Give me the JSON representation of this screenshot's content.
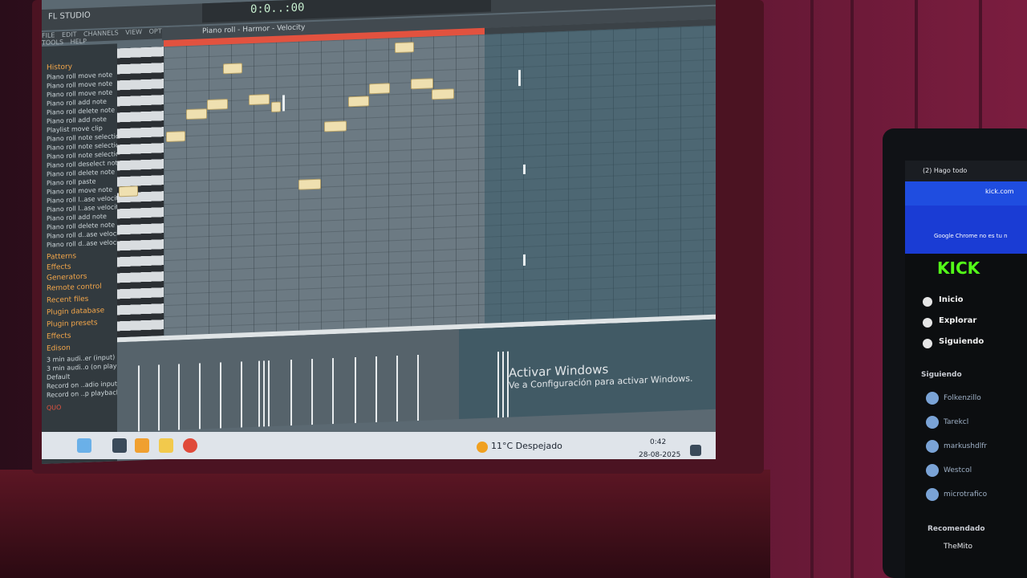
{
  "fl_studio": {
    "app_title": "FL STUDIO",
    "time_display": "0:0..:00",
    "menu": [
      "FILE",
      "EDIT",
      "CHANNELS",
      "VIEW",
      "OPTIONS",
      "TOOLS",
      "HELP"
    ],
    "piano_roll_title": "Piano roll - Harmor - Velocity",
    "browser": {
      "history_label": "History",
      "history_items": [
        "Piano roll move note",
        "Piano roll move note",
        "Piano roll move note",
        "Piano roll add note",
        "Piano roll delete note",
        "Piano roll add note",
        "Playlist move clip",
        "Piano roll note selection",
        "Piano roll note selection",
        "Piano roll note selection",
        "Piano roll deselect note",
        "Piano roll delete note",
        "Piano roll paste",
        "Piano roll move note",
        "Piano roll l..ase velocity",
        "Piano roll l..ase velocity",
        "Piano roll add note",
        "Piano roll delete note",
        "Piano roll d..ase velocity",
        "Piano roll d..ase velocity"
      ],
      "categories": [
        "Patterns",
        "Effects",
        "Generators",
        "Remote control",
        "Recent files",
        "Plugin database",
        "Plugin presets",
        "Effects",
        "Edison"
      ],
      "recent_items": [
        "3 min audi..er (input)",
        "3 min audi..o (on play)",
        "Default",
        "Record on ..adio input",
        "Record on ..p playback"
      ],
      "bottom_label": "QUO"
    }
  },
  "windows": {
    "activate_title": "Activar Windows",
    "activate_sub": "Ve a Configuración para activar Windows.",
    "weather": "11°C  Despejado",
    "clock_time": "0:42",
    "clock_date": "28-08-2025"
  },
  "phone": {
    "tab_label": "(2) Hago todo",
    "url": "kick.com",
    "banner": "Google Chrome no es tu n",
    "logo": "KICK",
    "nav": [
      "Inicio",
      "Explorar",
      "Siguiendo"
    ],
    "following_title": "Siguiendo",
    "following": [
      "Folkenzillo",
      "Tarekcl",
      "markushdlfr",
      "Westcol",
      "microtrafico"
    ],
    "recommended_title": "Recomendado",
    "recommended_first": "TheMito"
  },
  "colors": {
    "fl_grid": "#6c7a83",
    "note_fill": "#efe0b0",
    "loop_marker": "#e2523f",
    "kick_green": "#53fc18",
    "chrome_blue": "#1f4de0"
  }
}
